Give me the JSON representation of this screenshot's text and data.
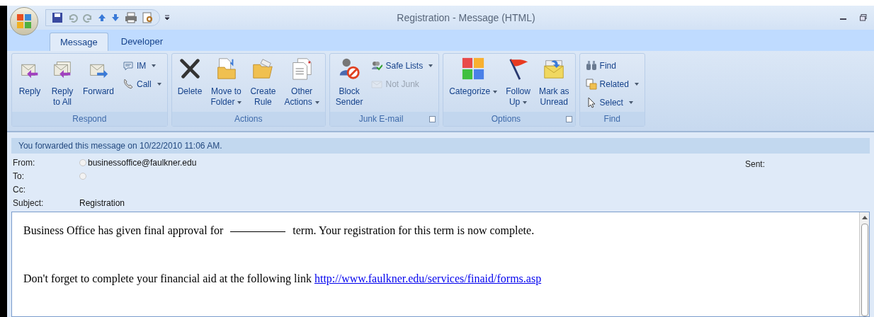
{
  "window": {
    "title": "Registration - Message (HTML)"
  },
  "tabs": [
    {
      "label": "Message",
      "selected": true
    },
    {
      "label": "Developer",
      "selected": false
    }
  ],
  "ribbon_groups": [
    {
      "label": "Respond",
      "launcher": false,
      "items": [
        {
          "kind": "large",
          "lines": [
            "Reply"
          ],
          "dropdown": false,
          "disabled": false
        },
        {
          "kind": "large",
          "lines": [
            "Reply",
            "to All"
          ],
          "dropdown": false,
          "disabled": false
        },
        {
          "kind": "large",
          "lines": [
            "Forward"
          ],
          "dropdown": false,
          "disabled": false
        },
        {
          "kind": "small",
          "lines": [
            "IM"
          ],
          "dropdown": true,
          "disabled": false
        },
        {
          "kind": "small",
          "lines": [
            "Call"
          ],
          "dropdown": true,
          "disabled": false
        }
      ]
    },
    {
      "label": "Actions",
      "launcher": false,
      "items": [
        {
          "kind": "large",
          "lines": [
            "Delete"
          ],
          "dropdown": false,
          "disabled": false
        },
        {
          "kind": "large",
          "lines": [
            "Move to",
            "Folder"
          ],
          "dropdown": true,
          "disabled": false
        },
        {
          "kind": "large",
          "lines": [
            "Create",
            "Rule"
          ],
          "dropdown": false,
          "disabled": false
        },
        {
          "kind": "large",
          "lines": [
            "Other",
            "Actions"
          ],
          "dropdown": true,
          "disabled": false
        }
      ]
    },
    {
      "label": "Junk E-mail",
      "launcher": true,
      "items": [
        {
          "kind": "large",
          "lines": [
            "Block",
            "Sender"
          ],
          "dropdown": false,
          "disabled": false
        },
        {
          "kind": "small",
          "lines": [
            "Safe Lists"
          ],
          "dropdown": true,
          "disabled": false
        },
        {
          "kind": "small",
          "lines": [
            "Not Junk"
          ],
          "dropdown": false,
          "disabled": true
        }
      ]
    },
    {
      "label": "Options",
      "launcher": true,
      "items": [
        {
          "kind": "large",
          "lines": [
            "Categorize"
          ],
          "dropdown": true,
          "disabled": false
        },
        {
          "kind": "large",
          "lines": [
            "Follow",
            "Up"
          ],
          "dropdown": true,
          "disabled": false
        },
        {
          "kind": "large",
          "lines": [
            "Mark as",
            "Unread"
          ],
          "dropdown": false,
          "disabled": false
        }
      ]
    },
    {
      "label": "Find",
      "launcher": false,
      "items": [
        {
          "kind": "small",
          "lines": [
            "Find"
          ],
          "dropdown": false,
          "disabled": false
        },
        {
          "kind": "small",
          "lines": [
            "Related"
          ],
          "dropdown": true,
          "disabled": false
        },
        {
          "kind": "small",
          "lines": [
            "Select"
          ],
          "dropdown": true,
          "disabled": false
        }
      ]
    }
  ],
  "info_bar": "You forwarded this message on 10/22/2010 11:06 AM.",
  "header_fields": [
    {
      "label": "From:",
      "value": "businessoffice@faulkner.edu",
      "presence": true
    },
    {
      "label": "To:",
      "presence": true
    },
    {
      "label": "Cc:",
      "presence": false
    },
    {
      "label": "Subject:",
      "value": "Registration",
      "presence": false
    }
  ],
  "sent_label": "Sent:",
  "body": [
    {
      "kind": "blank",
      "before": "Business Office has given final approval for",
      "after": "term. Your registration for this term is now complete."
    },
    {
      "kind": "link",
      "before": "Don't forget to complete your financial aid at the following link",
      "link": "http://www.faulkner.edu/services/finaid/forms.asp"
    }
  ]
}
